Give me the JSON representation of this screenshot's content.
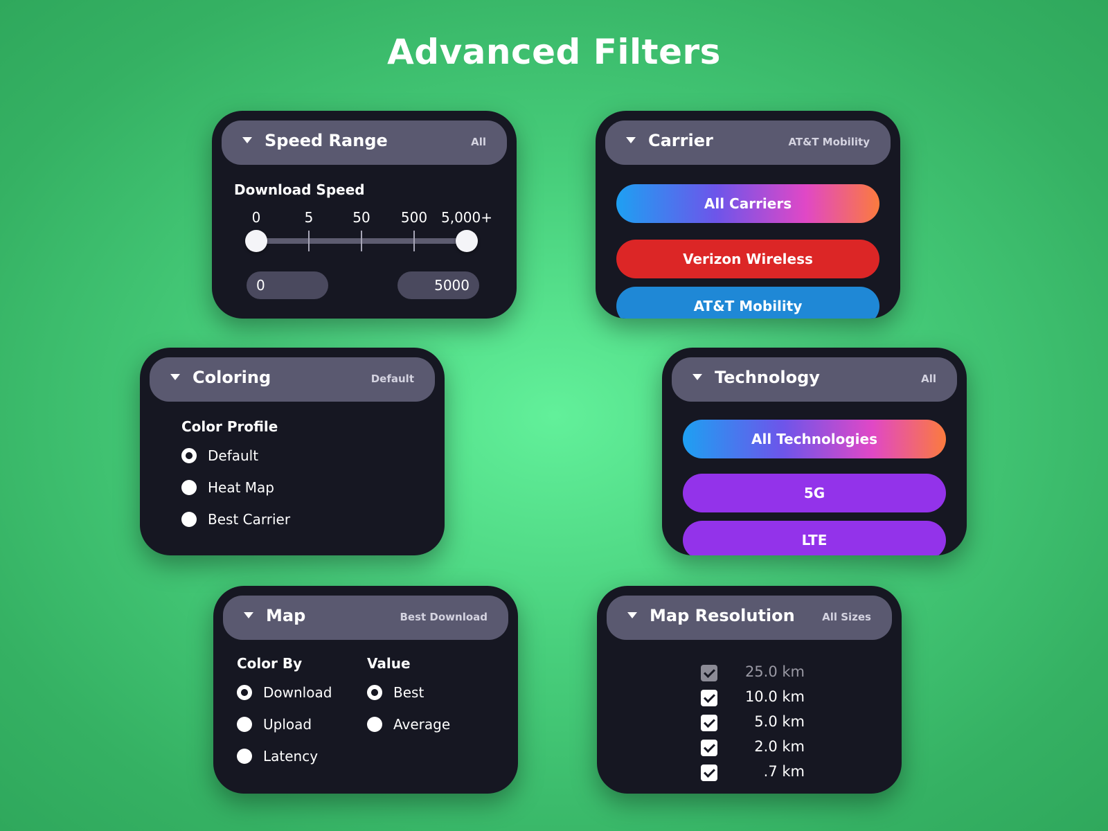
{
  "page": {
    "title": "Advanced Filters"
  },
  "speed_range": {
    "title": "Speed Range",
    "value": "All",
    "section_label": "Download Speed",
    "ticks": [
      "0",
      "5",
      "50",
      "500",
      "5,000+"
    ],
    "min_input": "0",
    "max_input": "5000"
  },
  "carrier": {
    "title": "Carrier",
    "value": "AT&T Mobility",
    "options": [
      "All Carriers",
      "Verizon Wireless",
      "AT&T Mobility"
    ]
  },
  "coloring": {
    "title": "Coloring",
    "value": "Default",
    "section_label": "Color Profile",
    "options": [
      "Default",
      "Heat Map",
      "Best Carrier"
    ],
    "selected": "Default"
  },
  "technology": {
    "title": "Technology",
    "value": "All",
    "options": [
      "All Technologies",
      "5G",
      "LTE"
    ]
  },
  "map": {
    "title": "Map",
    "value": "Best Download",
    "color_by_label": "Color By",
    "color_by_options": [
      "Download",
      "Upload",
      "Latency"
    ],
    "value_label": "Value",
    "value_options": [
      "Best",
      "Average"
    ]
  },
  "map_resolution": {
    "title": "Map Resolution",
    "value": "All Sizes",
    "options": [
      "25.0 km",
      "10.0 km",
      "5.0 km",
      "2.0 km",
      ".7 km"
    ]
  },
  "colors": {
    "background": "#48cf7c",
    "panel": "#161722",
    "header": "#5a5970",
    "red": "#dc2626",
    "blue": "#1f88d6",
    "purple": "#9333ea"
  }
}
